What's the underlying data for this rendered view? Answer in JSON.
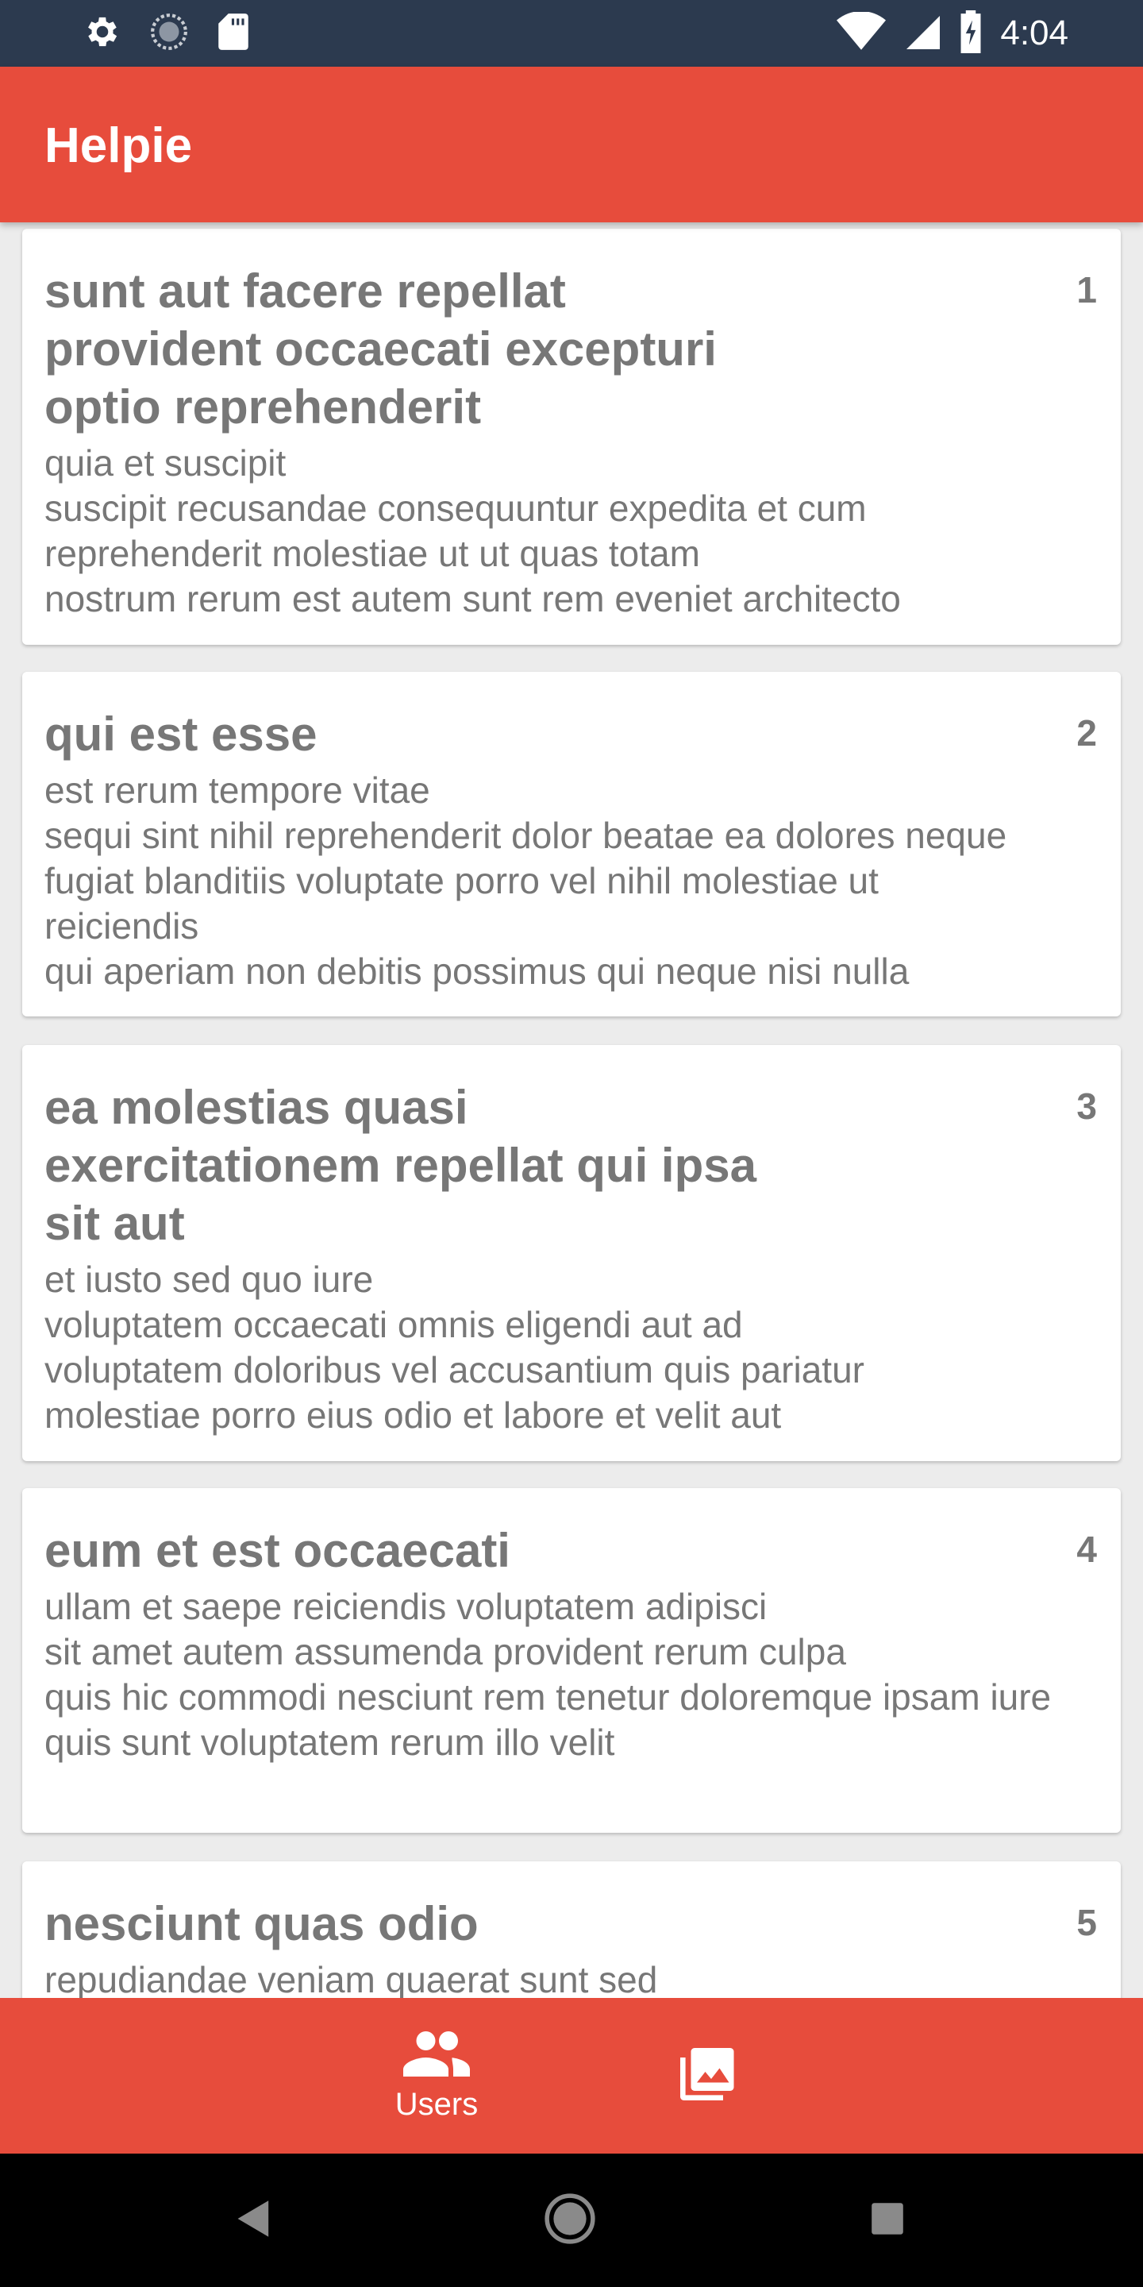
{
  "status_bar": {
    "time": "4:04",
    "icons_left": [
      "settings-icon",
      "sync-icon",
      "sd-card-icon"
    ],
    "icons_right": [
      "wifi-icon",
      "signal-icon",
      "battery-icon"
    ]
  },
  "app_bar": {
    "title": "Helpie"
  },
  "posts": [
    {
      "id": "1",
      "title": "sunt aut facere repellat provident occaecati excepturi optio reprehenderit",
      "body": [
        "quia et suscipit",
        "suscipit recusandae consequuntur expedita et cum",
        "reprehenderit molestiae ut ut quas totam",
        "nostrum rerum est autem sunt rem eveniet architecto"
      ]
    },
    {
      "id": "2",
      "title": "qui est esse",
      "body": [
        "est rerum tempore vitae",
        "sequi sint nihil reprehenderit dolor beatae ea dolores neque",
        "fugiat blanditiis voluptate porro vel nihil molestiae ut reiciendis",
        "qui aperiam non debitis possimus qui neque nisi nulla"
      ]
    },
    {
      "id": "3",
      "title": "ea molestias quasi exercitationem repellat qui ipsa sit aut",
      "body": [
        "et iusto sed quo iure",
        "voluptatem occaecati omnis eligendi aut ad",
        "voluptatem doloribus vel accusantium quis pariatur",
        "molestiae porro eius odio et labore et velit aut"
      ]
    },
    {
      "id": "4",
      "title": "eum et est occaecati",
      "body": [
        "ullam et saepe reiciendis voluptatem adipisci",
        "sit amet autem assumenda provident rerum culpa",
        "quis hic commodi nesciunt rem tenetur doloremque ipsam iure",
        "quis sunt voluptatem rerum illo velit"
      ]
    },
    {
      "id": "5",
      "title": "nesciunt quas odio",
      "body": [
        "repudiandae veniam quaerat sunt sed"
      ]
    }
  ],
  "bottom_nav": {
    "items": [
      {
        "label": "Users",
        "icon": "people-icon"
      },
      {
        "label": "",
        "icon": "photo-library-icon"
      }
    ]
  },
  "system_nav": [
    "back-icon",
    "home-icon",
    "recents-icon"
  ],
  "colors": {
    "accent": "#e74c3c",
    "status_bar": "#2c3a4f",
    "background": "#ececec",
    "text": "#777777"
  }
}
